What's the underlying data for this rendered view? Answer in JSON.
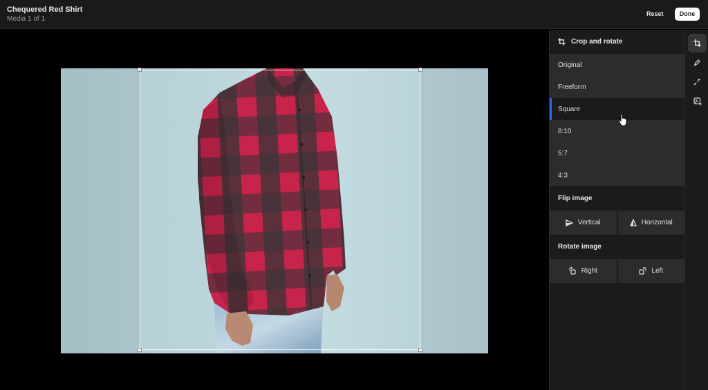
{
  "header": {
    "title": "Chequered Red Shirt",
    "subtitle": "Media 1 of 1",
    "reset_label": "Reset",
    "done_label": "Done"
  },
  "canvas": {
    "image_description": "Man wearing red and black chequered flannel shirt and light jeans against pale blue background",
    "background_color": "#000000",
    "crop_aspect": "Square"
  },
  "panel": {
    "header_icon": "crop-icon",
    "header_label": "Crop and rotate",
    "ratios": [
      {
        "label": "Original",
        "selected": false
      },
      {
        "label": "Freeform",
        "selected": false
      },
      {
        "label": "Square",
        "selected": true
      },
      {
        "label": "8:10",
        "selected": false
      },
      {
        "label": "5:7",
        "selected": false
      },
      {
        "label": "4:3",
        "selected": false
      }
    ],
    "flip": {
      "label": "Flip image",
      "buttons": [
        {
          "label": "Vertical",
          "icon": "flip-vertical-icon"
        },
        {
          "label": "Horizontal",
          "icon": "flip-horizontal-icon"
        }
      ]
    },
    "rotate": {
      "label": "Rotate image",
      "buttons": [
        {
          "label": "Right",
          "icon": "rotate-right-icon"
        },
        {
          "label": "Left",
          "icon": "rotate-left-icon"
        }
      ]
    }
  },
  "rail": {
    "tools": [
      {
        "name": "crop-tool",
        "icon": "crop-icon",
        "active": true
      },
      {
        "name": "draw-tool",
        "icon": "marker-icon",
        "active": false
      },
      {
        "name": "adjust-tool",
        "icon": "wand-icon",
        "active": false
      },
      {
        "name": "background-tool",
        "icon": "image-sparkle-icon",
        "active": false
      }
    ]
  },
  "colors": {
    "accent": "#2d6ce0",
    "panel_bg": "#1b1b1b",
    "list_bg": "#2c2c2c"
  }
}
